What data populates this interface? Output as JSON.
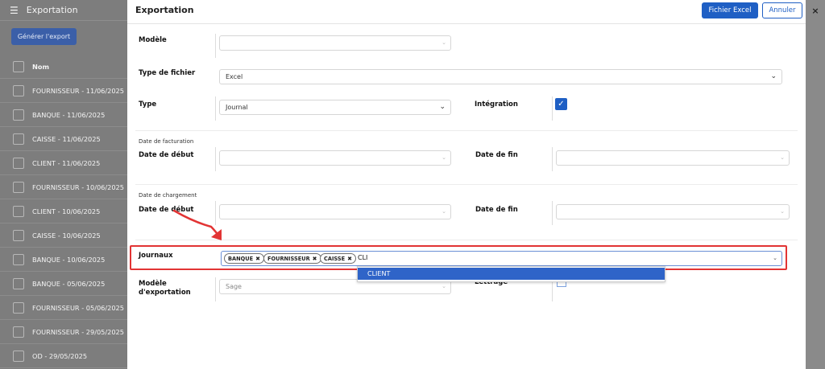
{
  "background": {
    "title": "Exportation",
    "generate_label": "Générer l'export",
    "column_header": "Nom",
    "rows": [
      "FOURNISSEUR - 11/06/2025",
      "BANQUE - 11/06/2025",
      "CAISSE - 11/06/2025",
      "CLIENT - 11/06/2025",
      "FOURNISSEUR - 10/06/2025",
      "CLIENT - 10/06/2025",
      "CAISSE - 10/06/2025",
      "BANQUE - 10/06/2025",
      "BANQUE - 05/06/2025",
      "FOURNISSEUR - 05/06/2025",
      "FOURNISSEUR - 29/05/2025",
      "OD - 29/05/2025"
    ]
  },
  "modal": {
    "title": "Exportation",
    "excel_label": "Fichier Excel",
    "cancel_label": "Annuler",
    "close_label": "×",
    "modele_label": "Modèle",
    "type_fichier_label": "Type de fichier",
    "type_fichier_value": "Excel",
    "type_label": "Type",
    "type_value": "Journal",
    "integration_label": "Intégration",
    "integration_checked": true,
    "facturation_section": "Date de facturation",
    "chargement_section": "Date de chargement",
    "date_debut_label": "Date de début",
    "date_fin_label": "Date de fin",
    "journaux_label": "Journaux",
    "journaux_tags": [
      "BANQUE",
      "FOURNISSEUR",
      "CAISSE"
    ],
    "journaux_typed": "CLI",
    "dropdown_option": "CLIENT",
    "modele_export_label_1": "Modèle",
    "modele_export_label_2": "d'exportation",
    "modele_export_value": "Sage",
    "lettrage_label": "Lettrage"
  },
  "icons": {
    "menu": "hamburger-icon",
    "check": "check-icon",
    "close": "close-icon",
    "caret": "chevron-down-icon"
  },
  "colors": {
    "accent": "#1f5fc4",
    "highlight": "#e23434",
    "selected_option": "#2f64c8"
  }
}
